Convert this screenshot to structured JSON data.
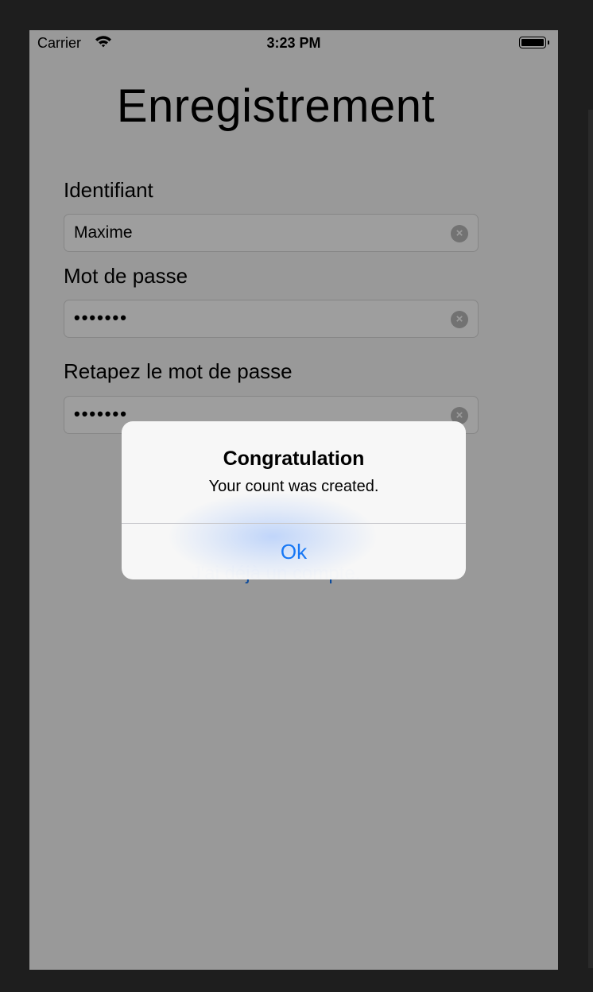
{
  "status_bar": {
    "carrier": "Carrier",
    "time": "3:23 PM"
  },
  "screen": {
    "title": "Enregistrement",
    "fields": [
      {
        "label": "Identifiant",
        "value": "Maxime",
        "secure": false
      },
      {
        "label": "Mot de passe",
        "value": "•••••••",
        "secure": true
      },
      {
        "label": "Retapez le mot de passe",
        "value": "•••••••",
        "secure": true
      }
    ],
    "login_link": "J'ai déjà un compte."
  },
  "alert": {
    "title": "Congratulation",
    "message": "Your count was created.",
    "button": "Ok"
  },
  "colors": {
    "accent": "#1677f5",
    "background": "#f2f2f2",
    "frame": "#1e1e1e"
  },
  "icons": {
    "wifi": "wifi-icon",
    "battery": "battery-icon",
    "clear": "clear-icon"
  }
}
